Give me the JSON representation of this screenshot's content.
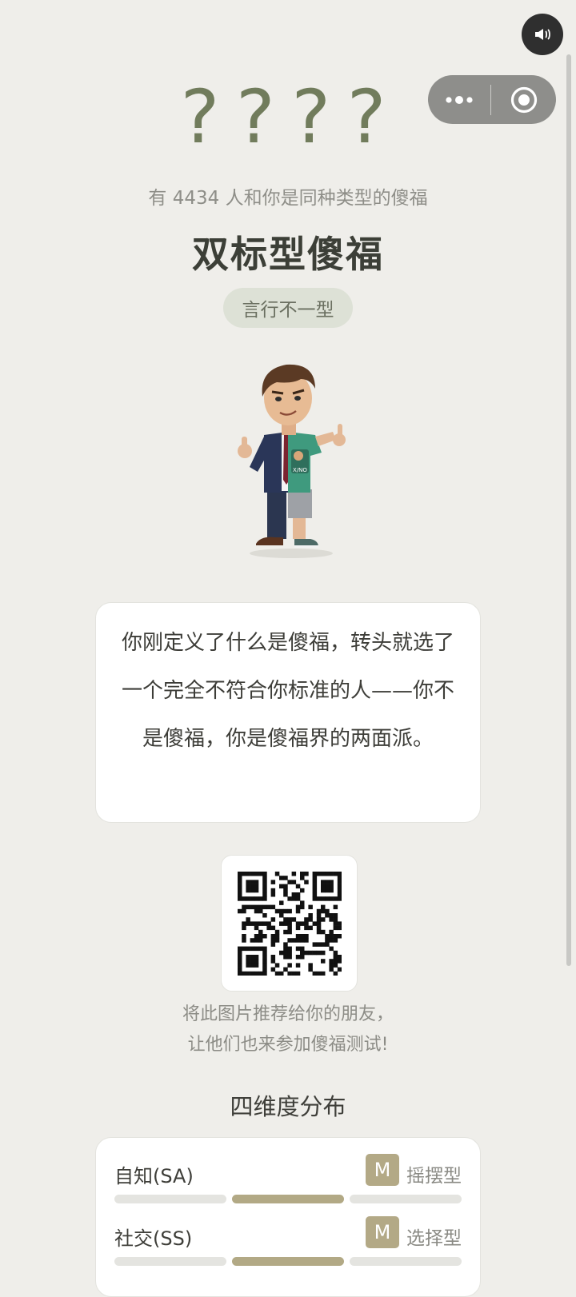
{
  "header": {
    "code": "????",
    "same_type_text": "有 4434 人和你是同种类型的傻福",
    "type_name": "双标型傻福",
    "type_tag": "言行不一型"
  },
  "avatar": {
    "shirt_text": "X/NO"
  },
  "description": "你刚定义了什么是傻福，转头就选了一个完全不符合你标准的人——你不是傻福，你是傻福界的两面派。",
  "share": {
    "line1": "将此图片推荐给你的朋友，",
    "line2": "让他们也来参加傻福测试!"
  },
  "dimensions": {
    "title": "四维度分布",
    "items": [
      {
        "label": "自知(SA)",
        "badge": "M",
        "type": "摇摆型",
        "level": 2,
        "levels": 3
      },
      {
        "label": "社交(SS)",
        "badge": "M",
        "type": "选择型",
        "level": 2,
        "levels": 3
      }
    ]
  },
  "colors": {
    "background": "#efeeea",
    "accent": "#717c5c",
    "badge": "#b3a986",
    "bar_active": "#b2a985",
    "bar_inactive": "#e4e4e0"
  },
  "icons": {
    "sound": "speaker-icon",
    "more": "more-dots-icon",
    "close": "target-circle-icon"
  }
}
